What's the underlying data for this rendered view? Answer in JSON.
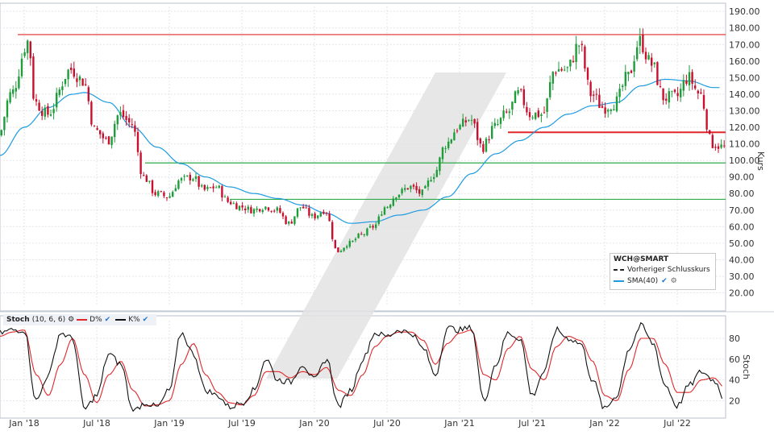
{
  "chart_data": [
    {
      "type": "candlestick",
      "title": "WCH@SMART",
      "ylabel": "Kurs",
      "ylim": [
        12,
        193
      ],
      "y_ticks": [
        "20.00",
        "30.00",
        "40.00",
        "50.00",
        "60.00",
        "70.00",
        "80.00",
        "90.00",
        "100.00",
        "110.00",
        "120.00",
        "130.00",
        "140.00",
        "150.00",
        "160.00",
        "170.00",
        "180.00",
        "190.00"
      ],
      "x_ticks": [
        "Jan '18",
        "Jul '18",
        "Jan '19",
        "Jul '19",
        "Jan '20",
        "Jul '20",
        "Jan '21",
        "Jul '21",
        "Jan '22",
        "Jul '22"
      ],
      "x_range": [
        "2017-11",
        "2022-11"
      ],
      "price_anchors": [
        [
          "2017-11",
          115
        ],
        [
          "2017-12",
          140
        ],
        [
          "2018-01-15",
          172
        ],
        [
          "2018-02",
          135
        ],
        [
          "2018-03",
          128
        ],
        [
          "2018-05",
          155
        ],
        [
          "2018-06",
          148
        ],
        [
          "2018-07",
          118
        ],
        [
          "2018-08",
          112
        ],
        [
          "2018-09",
          128
        ],
        [
          "2018-10",
          122
        ],
        [
          "2018-11",
          90
        ],
        [
          "2018-12",
          80
        ],
        [
          "2019-01",
          78
        ],
        [
          "2019-02",
          88
        ],
        [
          "2019-03",
          90
        ],
        [
          "2019-04",
          82
        ],
        [
          "2019-05",
          84
        ],
        [
          "2019-06",
          75
        ],
        [
          "2019-07",
          72
        ],
        [
          "2019-08",
          70
        ],
        [
          "2019-09",
          72
        ],
        [
          "2019-10",
          70
        ],
        [
          "2019-11",
          62
        ],
        [
          "2019-12",
          72
        ],
        [
          "2020-01",
          66
        ],
        [
          "2020-02",
          70
        ],
        [
          "2020-03",
          45
        ],
        [
          "2020-04",
          50
        ],
        [
          "2020-05",
          55
        ],
        [
          "2020-06",
          60
        ],
        [
          "2020-07",
          72
        ],
        [
          "2020-08",
          80
        ],
        [
          "2020-09",
          84
        ],
        [
          "2020-10",
          80
        ],
        [
          "2020-11",
          92
        ],
        [
          "2020-12",
          110
        ],
        [
          "2021-01",
          120
        ],
        [
          "2021-02",
          125
        ],
        [
          "2021-03",
          108
        ],
        [
          "2021-04",
          120
        ],
        [
          "2021-05",
          128
        ],
        [
          "2021-06",
          140
        ],
        [
          "2021-07",
          128
        ],
        [
          "2021-08",
          128
        ],
        [
          "2021-09",
          155
        ],
        [
          "2021-10",
          155
        ],
        [
          "2021-11",
          170
        ],
        [
          "2021-12",
          140
        ],
        [
          "2022-01",
          132
        ],
        [
          "2022-02",
          135
        ],
        [
          "2022-03",
          150
        ],
        [
          "2022-04",
          172
        ],
        [
          "2022-05",
          158
        ],
        [
          "2022-06",
          138
        ],
        [
          "2022-07",
          138
        ],
        [
          "2022-08",
          150
        ],
        [
          "2022-09",
          140
        ],
        [
          "2022-10",
          110
        ],
        [
          "2022-11",
          108
        ]
      ],
      "sma_anchors": [
        [
          "2017-11",
          103
        ],
        [
          "2018-01",
          120
        ],
        [
          "2018-03",
          132
        ],
        [
          "2018-05",
          140
        ],
        [
          "2018-06",
          141
        ],
        [
          "2018-08",
          135
        ],
        [
          "2018-10",
          120
        ],
        [
          "2018-12",
          108
        ],
        [
          "2019-02",
          98
        ],
        [
          "2019-04",
          90
        ],
        [
          "2019-06",
          84
        ],
        [
          "2019-08",
          80
        ],
        [
          "2019-10",
          77
        ],
        [
          "2019-12",
          73
        ],
        [
          "2020-02",
          68
        ],
        [
          "2020-04",
          62
        ],
        [
          "2020-06",
          63
        ],
        [
          "2020-08",
          67
        ],
        [
          "2020-10",
          70
        ],
        [
          "2020-12",
          78
        ],
        [
          "2021-02",
          92
        ],
        [
          "2021-04",
          104
        ],
        [
          "2021-06",
          112
        ],
        [
          "2021-08",
          120
        ],
        [
          "2021-10",
          128
        ],
        [
          "2021-12",
          133
        ],
        [
          "2022-02",
          135
        ],
        [
          "2022-04",
          145
        ],
        [
          "2022-06",
          149
        ],
        [
          "2022-08",
          148
        ],
        [
          "2022-10",
          144
        ]
      ],
      "horizontal_lines": [
        {
          "value": 176,
          "color": "#e0282a",
          "from": "2017-12-15",
          "to": "2022-11"
        },
        {
          "value": 117,
          "color": "#e0282a",
          "from": "2021-05-01",
          "to": "2022-11"
        },
        {
          "value": 98.5,
          "color": "#2eaa4a",
          "from": "2018-11-01",
          "to": "2022-11"
        },
        {
          "value": 76.5,
          "color": "#2eaa4a",
          "from": "2019-06-01",
          "to": "2022-11"
        }
      ],
      "colors": {
        "up": "#1f9d3a",
        "down": "#c8102e",
        "sma": "#1e9be0"
      },
      "legend": {
        "title": "WCH@SMART",
        "items": [
          {
            "label": "Vorheriger Schlusskurs",
            "style": "dashed"
          },
          {
            "label": "SMA(40)",
            "style": "line",
            "color": "#1e9be0"
          }
        ]
      }
    },
    {
      "type": "line",
      "title": "Stoch",
      "params": "(10, 6, 6)",
      "ylabel": "Stoch",
      "ylim": [
        8,
        97
      ],
      "y_ticks": [
        "20",
        "40",
        "60",
        "80"
      ],
      "series": [
        {
          "name": "D%",
          "color": "#e0282a"
        },
        {
          "name": "K%",
          "color": "#111111"
        }
      ],
      "k_anchors": [
        [
          "2017-11",
          85
        ],
        [
          "2017-12",
          88
        ],
        [
          "2018-01",
          88
        ],
        [
          "2018-02",
          20
        ],
        [
          "2018-03",
          45
        ],
        [
          "2018-04",
          85
        ],
        [
          "2018-05",
          80
        ],
        [
          "2018-06",
          12
        ],
        [
          "2018-07",
          25
        ],
        [
          "2018-08",
          65
        ],
        [
          "2018-09",
          55
        ],
        [
          "2018-10",
          10
        ],
        [
          "2018-11",
          18
        ],
        [
          "2018-12",
          14
        ],
        [
          "2019-01",
          30
        ],
        [
          "2019-02",
          85
        ],
        [
          "2019-03",
          65
        ],
        [
          "2019-04",
          30
        ],
        [
          "2019-05",
          25
        ],
        [
          "2019-06",
          14
        ],
        [
          "2019-07",
          18
        ],
        [
          "2019-08",
          30
        ],
        [
          "2019-09",
          60
        ],
        [
          "2019-10",
          40
        ],
        [
          "2019-11",
          38
        ],
        [
          "2019-12",
          55
        ],
        [
          "2020-01",
          40
        ],
        [
          "2020-02",
          60
        ],
        [
          "2020-03",
          15
        ],
        [
          "2020-04",
          30
        ],
        [
          "2020-05",
          60
        ],
        [
          "2020-06",
          85
        ],
        [
          "2020-07",
          82
        ],
        [
          "2020-08",
          88
        ],
        [
          "2020-09",
          85
        ],
        [
          "2020-10",
          70
        ],
        [
          "2020-11",
          45
        ],
        [
          "2020-12",
          90
        ],
        [
          "2021-01",
          88
        ],
        [
          "2021-02",
          90
        ],
        [
          "2021-03",
          20
        ],
        [
          "2021-04",
          55
        ],
        [
          "2021-05",
          85
        ],
        [
          "2021-06",
          80
        ],
        [
          "2021-07",
          25
        ],
        [
          "2021-08",
          48
        ],
        [
          "2021-09",
          88
        ],
        [
          "2021-10",
          80
        ],
        [
          "2021-11",
          75
        ],
        [
          "2021-12",
          40
        ],
        [
          "2022-01",
          12
        ],
        [
          "2022-02",
          25
        ],
        [
          "2022-03",
          70
        ],
        [
          "2022-04",
          92
        ],
        [
          "2022-05",
          75
        ],
        [
          "2022-06",
          35
        ],
        [
          "2022-07",
          15
        ],
        [
          "2022-08",
          35
        ],
        [
          "2022-09",
          48
        ],
        [
          "2022-10",
          40
        ],
        [
          "2022-11",
          20
        ]
      ],
      "d_anchors": [
        [
          "2017-11",
          82
        ],
        [
          "2017-12",
          86
        ],
        [
          "2018-01",
          88
        ],
        [
          "2018-02",
          45
        ],
        [
          "2018-03",
          25
        ],
        [
          "2018-04",
          55
        ],
        [
          "2018-05",
          80
        ],
        [
          "2018-06",
          45
        ],
        [
          "2018-07",
          18
        ],
        [
          "2018-08",
          45
        ],
        [
          "2018-09",
          58
        ],
        [
          "2018-10",
          30
        ],
        [
          "2018-11",
          15
        ],
        [
          "2018-12",
          16
        ],
        [
          "2019-01",
          20
        ],
        [
          "2019-02",
          55
        ],
        [
          "2019-03",
          75
        ],
        [
          "2019-04",
          45
        ],
        [
          "2019-05",
          28
        ],
        [
          "2019-06",
          18
        ],
        [
          "2019-07",
          16
        ],
        [
          "2019-08",
          25
        ],
        [
          "2019-09",
          48
        ],
        [
          "2019-10",
          48
        ],
        [
          "2019-11",
          42
        ],
        [
          "2019-12",
          48
        ],
        [
          "2020-01",
          45
        ],
        [
          "2020-02",
          52
        ],
        [
          "2020-03",
          30
        ],
        [
          "2020-04",
          25
        ],
        [
          "2020-05",
          45
        ],
        [
          "2020-06",
          72
        ],
        [
          "2020-07",
          82
        ],
        [
          "2020-08",
          86
        ],
        [
          "2020-09",
          86
        ],
        [
          "2020-10",
          78
        ],
        [
          "2020-11",
          55
        ],
        [
          "2020-12",
          75
        ],
        [
          "2021-01",
          85
        ],
        [
          "2021-02",
          88
        ],
        [
          "2021-03",
          45
        ],
        [
          "2021-04",
          40
        ],
        [
          "2021-05",
          70
        ],
        [
          "2021-06",
          82
        ],
        [
          "2021-07",
          50
        ],
        [
          "2021-08",
          40
        ],
        [
          "2021-09",
          72
        ],
        [
          "2021-10",
          82
        ],
        [
          "2021-11",
          78
        ],
        [
          "2021-12",
          58
        ],
        [
          "2022-01",
          25
        ],
        [
          "2022-02",
          20
        ],
        [
          "2022-03",
          50
        ],
        [
          "2022-04",
          80
        ],
        [
          "2022-05",
          80
        ],
        [
          "2022-06",
          55
        ],
        [
          "2022-07",
          28
        ],
        [
          "2022-08",
          28
        ],
        [
          "2022-09",
          40
        ],
        [
          "2022-10",
          42
        ],
        [
          "2022-11",
          32
        ]
      ],
      "legend": [
        {
          "label": "D%",
          "color": "#e0282a"
        },
        {
          "label": "K%",
          "color": "#111111"
        }
      ]
    }
  ]
}
